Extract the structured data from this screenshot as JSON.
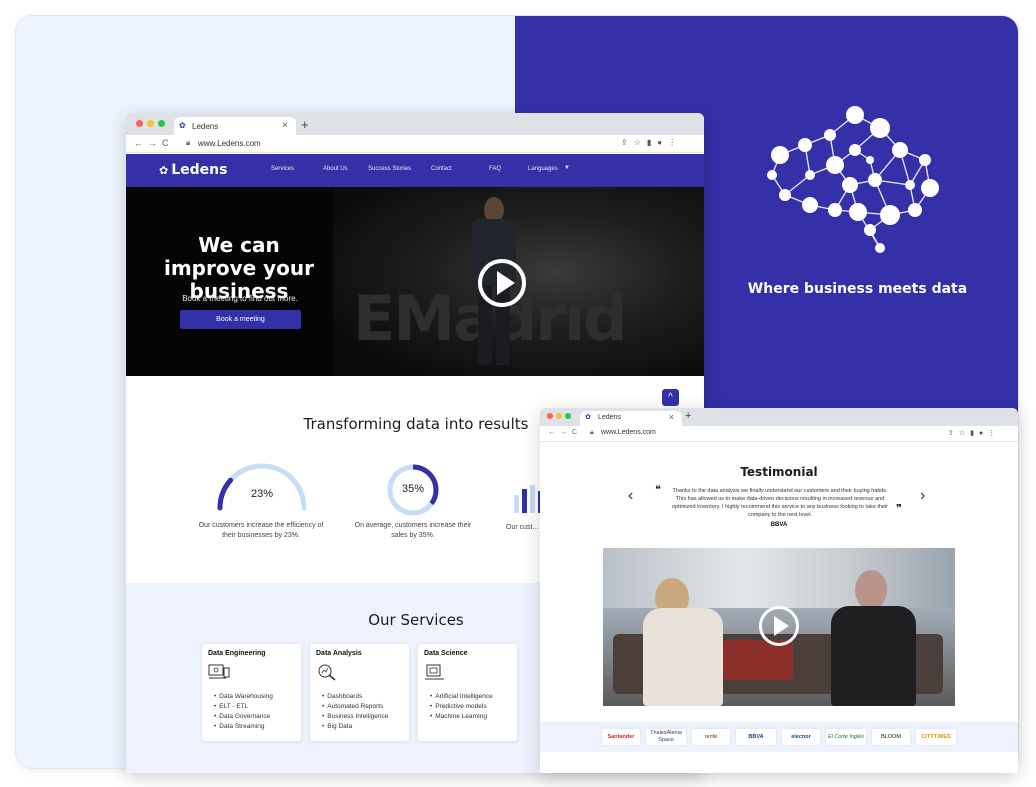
{
  "tagline": "Where business meets data",
  "browser_main": {
    "tab_title": "Ledens",
    "tab_close": "×",
    "new_tab": "+",
    "nav_buttons": "←→C",
    "url": "www.Ledens.com",
    "right_icons": "⇪☆▮●⋮"
  },
  "site": {
    "logo": "Ledens",
    "nav": [
      "Services",
      "About Us",
      "Success Stories",
      "Contact",
      "FAQ",
      "Languages"
    ],
    "hero": {
      "title": "We can improve your business",
      "subtitle": "Book a meeting to find out more.",
      "button": "Book a meeting",
      "video_bg_text": "EMadrid"
    },
    "scroll_top": "^",
    "results": {
      "title": "Transforming data into results",
      "stats": [
        {
          "value": "23%",
          "percent": 23,
          "caption": "Our customers increase the efficiency of their businesses by 23%."
        },
        {
          "value": "35%",
          "percent": 35,
          "caption": "On average, customers increase their sales by 35%."
        },
        {
          "value": "",
          "caption": "Our cust... revenue in r..."
        }
      ]
    },
    "services": {
      "title": "Our Services",
      "cards": [
        {
          "title": "Data Engineering",
          "items": [
            "Data Warehousing",
            "ELT - ETL",
            "Data Governance",
            "Data Streaming"
          ]
        },
        {
          "title": "Data Analysis",
          "items": [
            "Dashboards",
            "Automated Reports",
            "Business Intelligence",
            "Big Data"
          ]
        },
        {
          "title": "Data Science",
          "items": [
            "Artificial Intelligence",
            "Predictive models",
            "Machine Learning"
          ]
        }
      ]
    }
  },
  "browser_second": {
    "tab_title": "Ledens",
    "tab_close": "×",
    "new_tab": "+",
    "nav_buttons": "←→C",
    "url": "www.Ledens.com",
    "right_icons": "⇪☆▮●⋮",
    "testimonial": {
      "title": "Testimonial",
      "open_quote": "❝",
      "close_quote": "❞",
      "quote": "Thanks to the data analysis we finally understand our customers and their buying habits. This has allowed us to make data-driven decisions resulting in increased revenue and optimized inventory. I highly recommend this service to any business looking to take their company to the next level.",
      "author": "BBVA",
      "prev": "‹",
      "next": "›"
    },
    "client_logos": [
      "Santander",
      "ThalesAlenia Space",
      "renfe",
      "BBVA",
      "elecnor",
      "El Corte Inglés",
      "BLOOM",
      "CITYTIMES"
    ]
  },
  "colors": {
    "brand": "#3330a8",
    "accent_light": "#c7dcf7"
  }
}
